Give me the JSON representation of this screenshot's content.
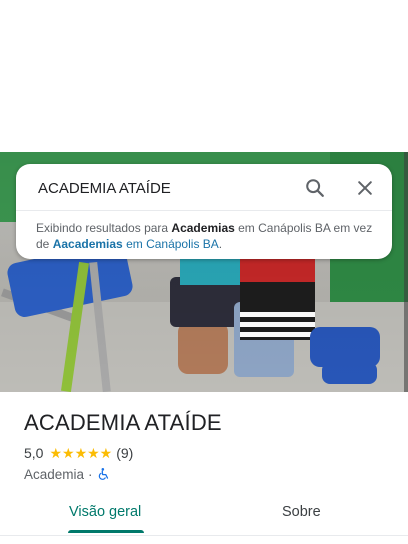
{
  "search": {
    "query": "ACADEMIA ATAÍDE",
    "search_icon": "search-icon",
    "close_icon": "close-icon",
    "suggestion": {
      "prefix": "Exibindo resultados para ",
      "term_shown": "Academias",
      "middle": " em Canápolis BA em vez de ",
      "term_original": "Aacademias",
      "location_link": " em Canápolis BA",
      "suffix": "."
    }
  },
  "place": {
    "photo_icon": "place-photo",
    "name": "ACADEMIA ATAÍDE",
    "rating": "5,0",
    "stars": "★★★★★",
    "review_count": "(9)",
    "category": "Academia",
    "separator": "·",
    "accessibility_icon": "wheelchair-icon"
  },
  "tabs": [
    {
      "label": "Visão geral",
      "active": true
    },
    {
      "label": "Sobre",
      "active": false
    }
  ],
  "colors": {
    "accent": "#00796b",
    "link": "#1a73a8",
    "star": "#fbbc04"
  }
}
